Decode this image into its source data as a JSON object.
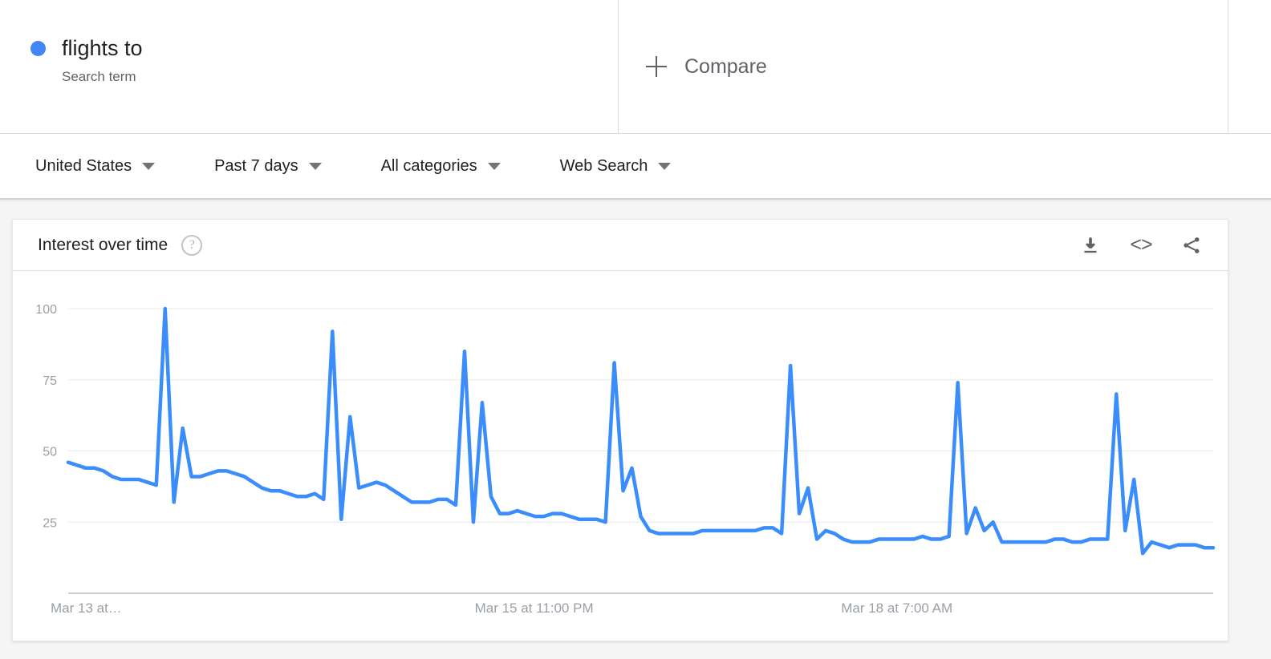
{
  "term_bar": {
    "term": {
      "label": "flights to",
      "type_label": "Search term",
      "dot_color": "#4285f4"
    },
    "compare": {
      "label": "Compare",
      "plus_icon": "plus-icon"
    }
  },
  "filters": [
    {
      "label": "United States",
      "caret_icon": "chevron-down-icon"
    },
    {
      "label": "Past 7 days",
      "caret_icon": "chevron-down-icon"
    },
    {
      "label": "All categories",
      "caret_icon": "chevron-down-icon"
    },
    {
      "label": "Web Search",
      "caret_icon": "chevron-down-icon"
    }
  ],
  "card": {
    "title": "Interest over time",
    "help_icon_glyph": "?",
    "actions": [
      {
        "name": "download-button",
        "icon": "download-icon"
      },
      {
        "name": "embed-button",
        "icon": "embed-code-icon",
        "glyph": "<>"
      },
      {
        "name": "share-button",
        "icon": "share-icon"
      }
    ]
  },
  "chart_data": {
    "type": "line",
    "title": "Interest over time",
    "xlabel": "",
    "ylabel": "",
    "ylim": [
      0,
      100
    ],
    "yticks": [
      25,
      50,
      75,
      100
    ],
    "grid": true,
    "legend": false,
    "line_color": "#3a8dfa",
    "xtick_labels": [
      "Mar 13 at…",
      "Mar 15 at 11:00 PM",
      "Mar 18 at 7:00 AM"
    ],
    "xtick_positions_pct": [
      0.0,
      0.355,
      0.675
    ],
    "series": [
      {
        "name": "flights to",
        "values": [
          46,
          45,
          44,
          44,
          43,
          41,
          40,
          40,
          40,
          39,
          38,
          100,
          32,
          58,
          41,
          41,
          42,
          43,
          43,
          42,
          41,
          39,
          37,
          36,
          36,
          35,
          34,
          34,
          35,
          33,
          92,
          26,
          62,
          37,
          38,
          39,
          38,
          36,
          34,
          32,
          32,
          32,
          33,
          33,
          31,
          85,
          25,
          67,
          34,
          28,
          28,
          29,
          28,
          27,
          27,
          28,
          28,
          27,
          26,
          26,
          26,
          25,
          81,
          36,
          44,
          27,
          22,
          21,
          21,
          21,
          21,
          21,
          22,
          22,
          22,
          22,
          22,
          22,
          22,
          23,
          23,
          21,
          80,
          28,
          37,
          19,
          22,
          21,
          19,
          18,
          18,
          18,
          19,
          19,
          19,
          19,
          19,
          20,
          19,
          19,
          20,
          74,
          21,
          30,
          22,
          25,
          18,
          18,
          18,
          18,
          18,
          18,
          19,
          19,
          18,
          18,
          19,
          19,
          19,
          70,
          22,
          40,
          14,
          18,
          17,
          16,
          17,
          17,
          17,
          16,
          16
        ]
      }
    ],
    "annotations": []
  }
}
